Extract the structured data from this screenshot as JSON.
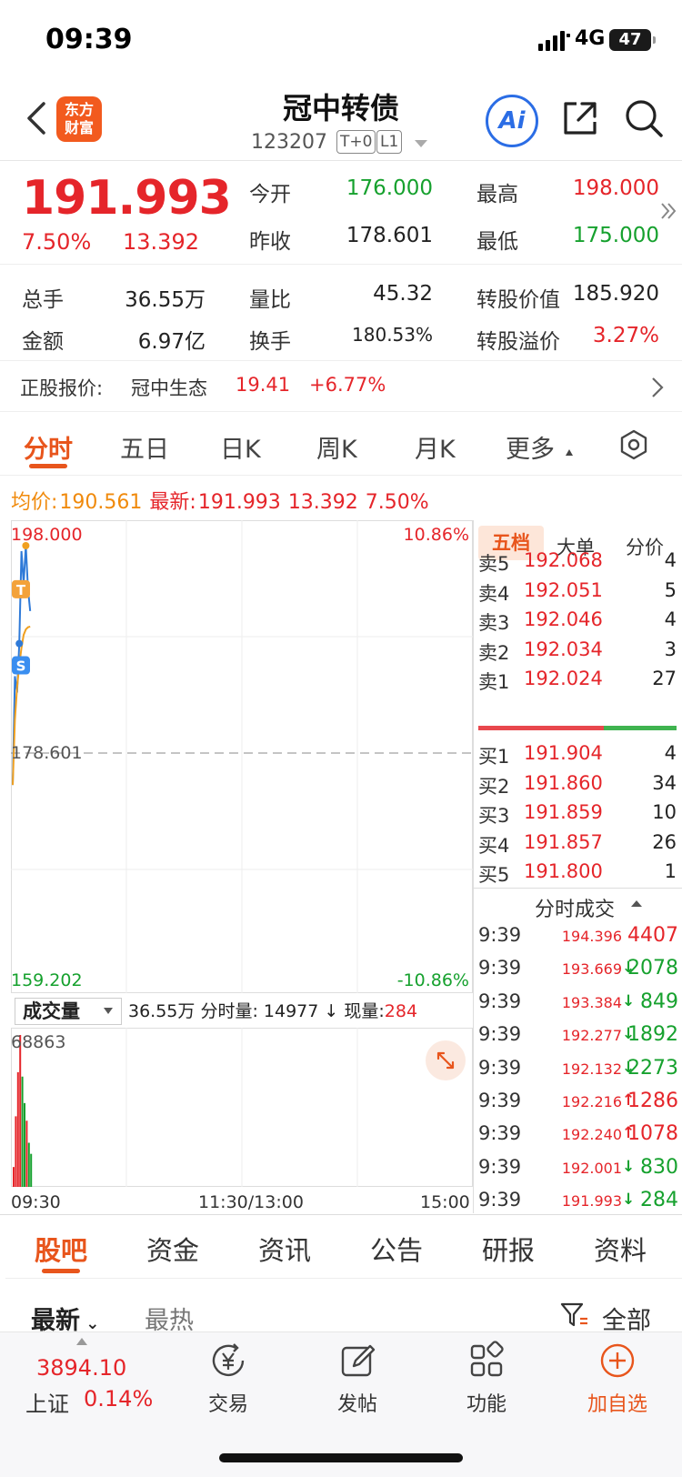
{
  "status_bar": {
    "time": "09:39",
    "network": "4G",
    "battery": "47"
  },
  "header": {
    "brand_logo": "东方\n财富",
    "title": "冠中转债",
    "code": "123207",
    "tags": [
      "T+0",
      "L1"
    ],
    "ai_label": "Ai"
  },
  "quote": {
    "last_price": "191.993",
    "change_pct": "7.50%",
    "change_amt": "13.392",
    "open_label": "今开",
    "open": "176.000",
    "high_label": "最高",
    "high": "198.000",
    "prev_close_label": "昨收",
    "prev_close": "178.601",
    "low_label": "最低",
    "low": "175.000",
    "volume_label": "总手",
    "volume": "36.55万",
    "vol_ratio_label": "量比",
    "vol_ratio": "45.32",
    "conv_value_label": "转股价值",
    "conv_value": "185.920",
    "amount_label": "金额",
    "amount": "6.97亿",
    "turnover_label": "换手",
    "turnover": "180.53%",
    "conv_premium_label": "转股溢价",
    "conv_premium": "3.27%",
    "colors": {
      "up": "#e5252a",
      "down": "#16a12e",
      "accent": "#e8551c"
    }
  },
  "underlying": {
    "label": "正股报价:",
    "name": "冠中生态",
    "price": "19.41",
    "change": "+6.77%"
  },
  "period_tabs": [
    "分时",
    "五日",
    "日K",
    "周K",
    "月K",
    "更多"
  ],
  "avg_line": {
    "avg_label": "均价:",
    "avg": "190.561",
    "latest_label": "最新:",
    "latest": "191.993",
    "chg": "13.392",
    "pct": "7.50%"
  },
  "chart_data": {
    "type": "line",
    "title": "",
    "price_max_label": "198.000",
    "price_min_label": "159.202",
    "price_ref_label": "178.601",
    "pct_max_label": "10.86%",
    "pct_min_label": "-10.86%",
    "ylim": [
      159.202,
      198.0
    ],
    "reference": 178.601,
    "x_labels": [
      "09:30",
      "11:30/13:00",
      "15:00"
    ],
    "total_minutes": 240,
    "series": [
      {
        "values": [
          176.0,
          186.0,
          184.5,
          189.0,
          197.5,
          194.5,
          198.0,
          194.0,
          191.993
        ]
      },
      {
        "values": [
          176.0,
          182.0,
          185.0,
          187.0,
          188.6,
          189.8,
          190.3,
          190.5,
          190.561
        ]
      }
    ],
    "markers": [
      {
        "label": "T",
        "value": 194.0
      },
      {
        "label": "S",
        "value": 187.0
      }
    ],
    "volume": {
      "max_label": "68863",
      "max": 68863,
      "bars": [
        {
          "v": 9000,
          "c": "red"
        },
        {
          "v": 32000,
          "c": "red"
        },
        {
          "v": 52000,
          "c": "red"
        },
        {
          "v": 68863,
          "c": "red"
        },
        {
          "v": 50000,
          "c": "green"
        },
        {
          "v": 38000,
          "c": "green"
        },
        {
          "v": 30000,
          "c": "red"
        },
        {
          "v": 20000,
          "c": "green"
        },
        {
          "v": 14977,
          "c": "green"
        }
      ]
    }
  },
  "volume_toolbar": {
    "selector": "成交量",
    "total": "36.55万",
    "minute_label": "分时量:",
    "minute_value": "14977",
    "arrow": "↓",
    "current_label": "现量:",
    "current_value": "284"
  },
  "order_book": {
    "tabs": [
      "五档",
      "大单",
      "分价"
    ],
    "asks": [
      {
        "label": "卖5",
        "price": "192.068",
        "qty": "4"
      },
      {
        "label": "卖4",
        "price": "192.051",
        "qty": "5"
      },
      {
        "label": "卖3",
        "price": "192.046",
        "qty": "4"
      },
      {
        "label": "卖2",
        "price": "192.034",
        "qty": "3"
      },
      {
        "label": "卖1",
        "price": "192.024",
        "qty": "27"
      }
    ],
    "bids": [
      {
        "label": "买1",
        "price": "191.904",
        "qty": "4"
      },
      {
        "label": "买2",
        "price": "191.860",
        "qty": "34"
      },
      {
        "label": "买3",
        "price": "191.859",
        "qty": "10"
      },
      {
        "label": "买4",
        "price": "191.857",
        "qty": "26"
      },
      {
        "label": "买5",
        "price": "191.800",
        "qty": "1"
      }
    ],
    "ticks_title": "分时成交",
    "ticks": [
      {
        "time": "9:39",
        "price": "194.396",
        "arrow": "",
        "vol": "4407",
        "dir": "up"
      },
      {
        "time": "9:39",
        "price": "193.669",
        "arrow": "↓",
        "vol": "2078",
        "dir": "down"
      },
      {
        "time": "9:39",
        "price": "193.384",
        "arrow": "↓",
        "vol": "849",
        "dir": "down"
      },
      {
        "time": "9:39",
        "price": "192.277",
        "arrow": "↓",
        "vol": "1892",
        "dir": "down"
      },
      {
        "time": "9:39",
        "price": "192.132",
        "arrow": "↓",
        "vol": "2273",
        "dir": "down"
      },
      {
        "time": "9:39",
        "price": "192.216",
        "arrow": "↑",
        "vol": "1286",
        "dir": "up"
      },
      {
        "time": "9:39",
        "price": "192.240",
        "arrow": "↑",
        "vol": "1078",
        "dir": "up"
      },
      {
        "time": "9:39",
        "price": "192.001",
        "arrow": "↓",
        "vol": "830",
        "dir": "down"
      },
      {
        "time": "9:39",
        "price": "191.993",
        "arrow": "↓",
        "vol": "284",
        "dir": "down"
      }
    ]
  },
  "content_tabs": [
    "股吧",
    "资金",
    "资讯",
    "公告",
    "研报",
    "资料"
  ],
  "sort": {
    "latest": "最新",
    "hot": "最热",
    "filter": "全部"
  },
  "bottom_nav": {
    "index_value": "3894.10",
    "index_name": "上证",
    "index_change": "0.14%",
    "items": [
      "交易",
      "发帖",
      "功能",
      "加自选"
    ]
  }
}
